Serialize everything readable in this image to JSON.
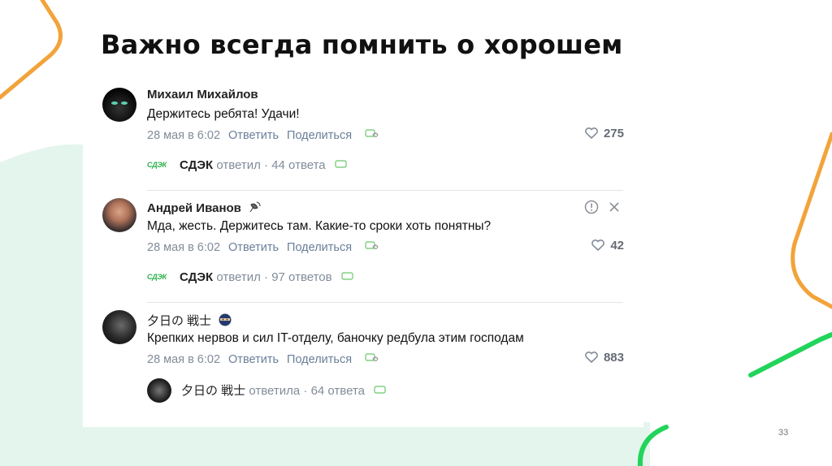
{
  "slide": {
    "title": "Важно всегда помнить о хорошем",
    "page_number": "33"
  },
  "brand_logo_text": "СДЭК",
  "comments": [
    {
      "author": "Михаил Михайлов",
      "text": "Держитесь ребята! Удачи!",
      "date": "28 мая в 6:02",
      "reply_action": "Ответить",
      "share_action": "Поделиться",
      "likes": "275",
      "thread": {
        "author": "СДЭК",
        "verb": "ответил",
        "count": "44 ответа"
      }
    },
    {
      "author": "Андрей Иванов",
      "text": "Мда, жесть. Держитесь там. Какие-то сроки хоть понятны?",
      "date": "28 мая в 6:02",
      "reply_action": "Ответить",
      "share_action": "Поделиться",
      "likes": "42",
      "thread": {
        "author": "СДЭК",
        "verb": "ответил",
        "count": "97 ответов"
      }
    },
    {
      "author": "夕日の 戦士",
      "text": "Крепких нервов и сил IT-отделу, баночку редбула этим господам",
      "date": "28 мая в 6:02",
      "reply_action": "Ответить",
      "share_action": "Поделиться",
      "likes": "883",
      "thread": {
        "author": "夕日の 戦士",
        "verb": "ответила",
        "count": "64 ответа"
      }
    }
  ],
  "colors": {
    "orange": "#f2a33a",
    "green": "#21d45a",
    "mint": "#e4f5ee",
    "link": "#6a7f99",
    "cdek_green": "#2fb24c"
  }
}
